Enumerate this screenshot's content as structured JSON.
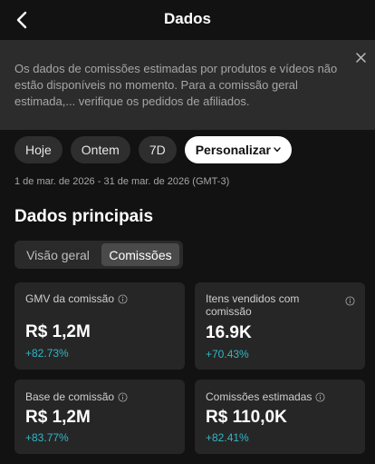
{
  "header": {
    "title": "Dados"
  },
  "notice": {
    "text": "Os dados de comissões estimadas por produtos e vídeos não estão disponíveis no momento. Para a comissão geral estimada,... verifique os pedidos de afiliados."
  },
  "filters": {
    "chips": [
      "Hoje",
      "Ontem",
      "7D",
      "Personalizar"
    ],
    "selected": "Personalizar"
  },
  "date_range": "1 de mar. de 2026 - 31 de mar. de 2026 (GMT-3)",
  "section": {
    "title": "Dados principais",
    "tabs": [
      "Visão geral",
      "Comissões"
    ],
    "selected_tab": "Comissões"
  },
  "metrics": [
    {
      "label": "GMV da comissão",
      "value": "R$ 1,2M",
      "change": "+82.73%"
    },
    {
      "label": "Itens vendidos com comissão",
      "value": "16.9K",
      "change": "+70.43%"
    },
    {
      "label": "Base de comissão",
      "value": "R$ 1,2M",
      "change": "+83.77%"
    },
    {
      "label": "Comissões estimadas",
      "value": "R$ 110,0K",
      "change": "+82.41%"
    }
  ],
  "colors": {
    "background": "#121212",
    "card": "#262626",
    "positive": "#2fb8c7",
    "notice_bg": "#2c2c2c"
  }
}
